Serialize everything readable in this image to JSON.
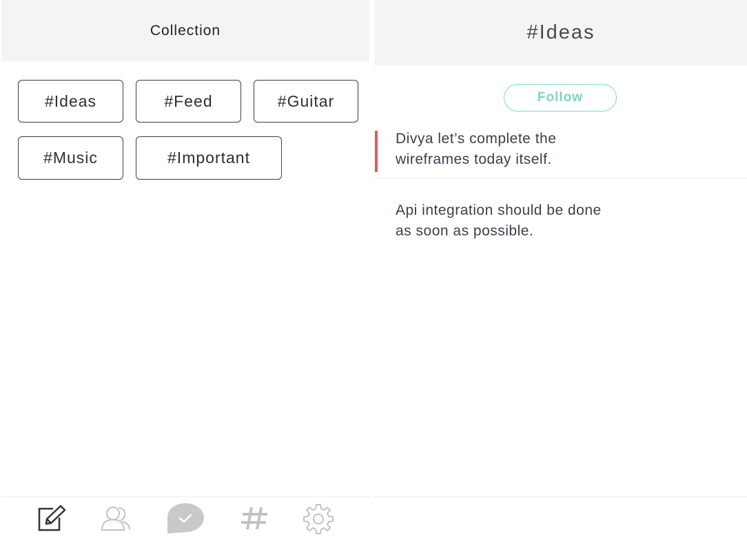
{
  "left": {
    "title": "Collection",
    "tags": [
      "#Ideas",
      "#Feed",
      "#Guitar",
      "#Music",
      "#Important"
    ],
    "tabbar": {
      "icons": [
        "compose-icon",
        "contacts-icon",
        "check-icon",
        "hashtag-icon",
        "settings-icon"
      ],
      "active_tab": "check-icon"
    }
  },
  "right": {
    "title": "#Ideas",
    "follow_label": "Follow",
    "messages": [
      {
        "line1": "Divya let’s complete the",
        "line2": "wireframes today itself."
      },
      {
        "line1": "Api integration should be done",
        "line2": "as soon as possible."
      }
    ]
  },
  "colors": {
    "accent": "#e05a5f",
    "follow": "#7ed9c4",
    "header_bg": "#f4f4f4",
    "icon_gray": "#c2c2c2",
    "active_bubble": "#c9c9c9"
  }
}
